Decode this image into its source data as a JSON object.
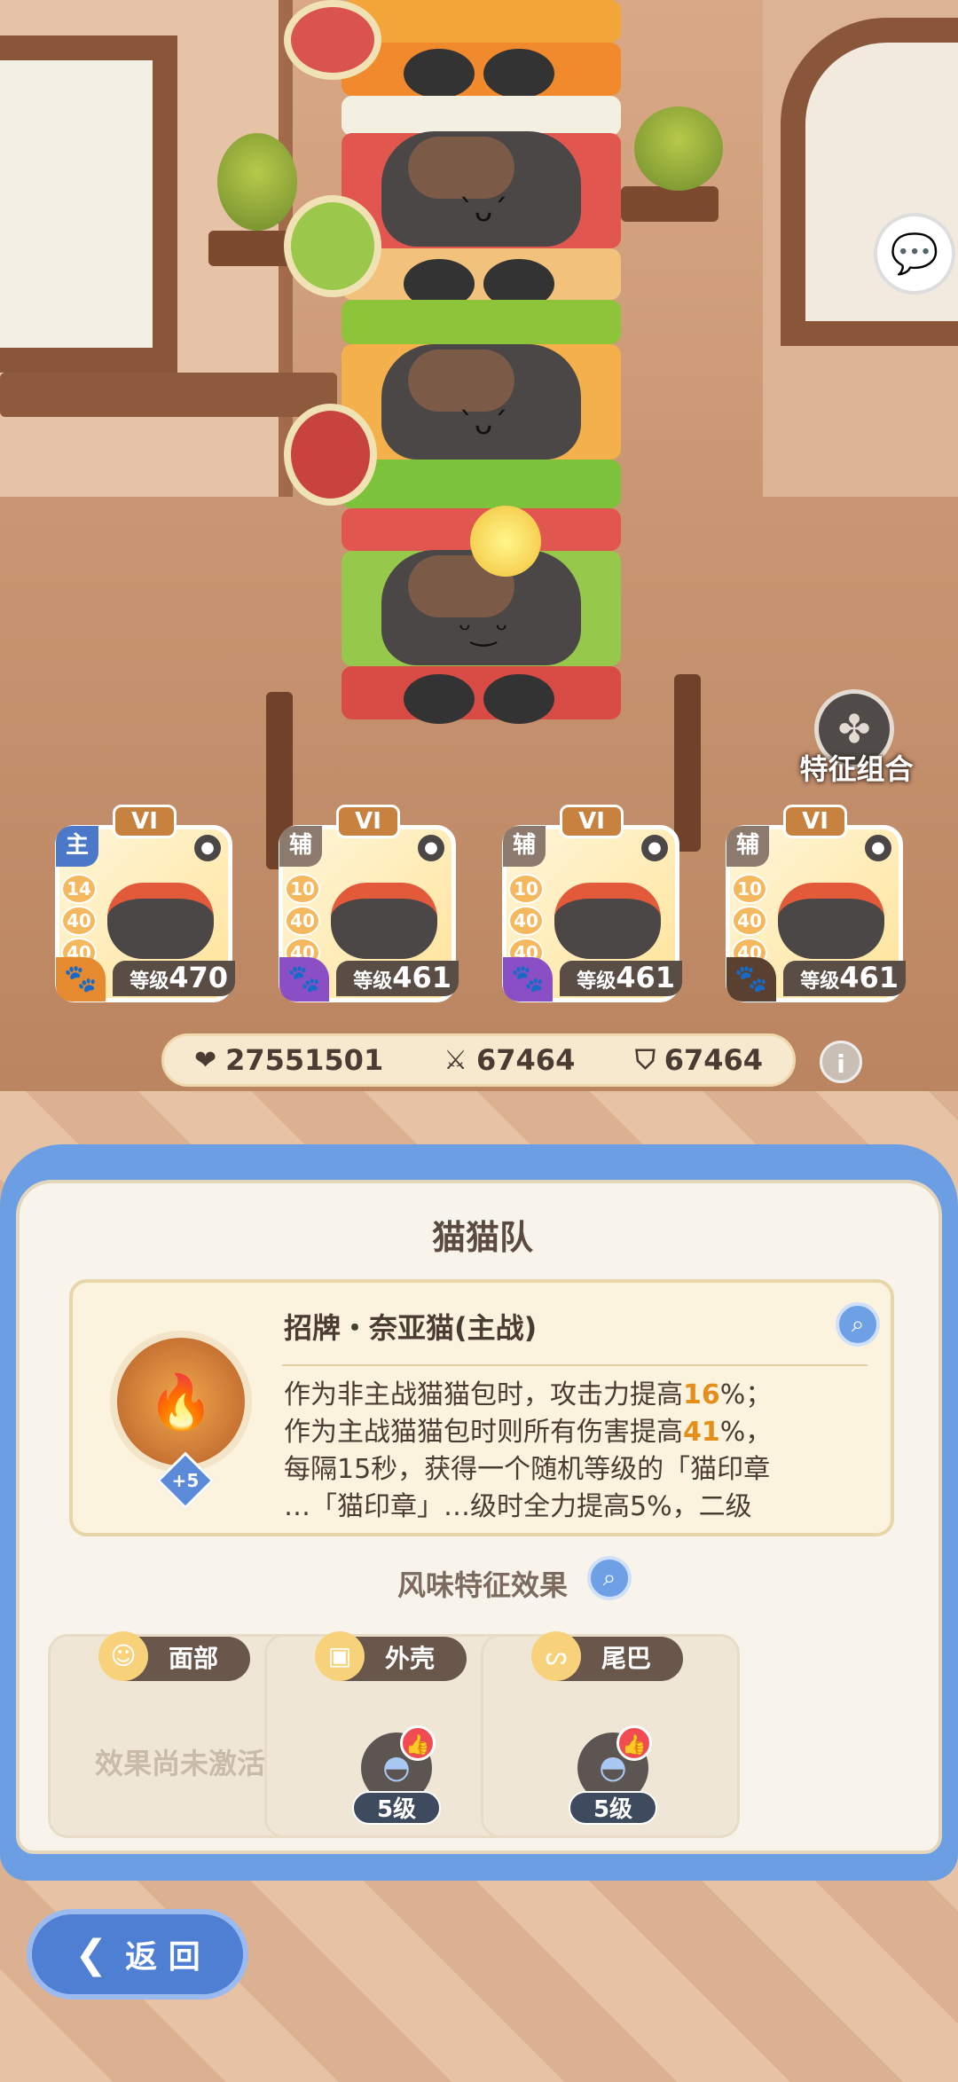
{
  "scene": {
    "chat_icon": "chat-bubble-icon",
    "trait_combo_label": "特征组合"
  },
  "team": {
    "members": [
      {
        "rank": "VI",
        "role": "主",
        "role_color": "#4c78c9",
        "stats": [
          "14",
          "40",
          "40"
        ],
        "level_prefix": "等级",
        "level": "470",
        "paw_color": "#e58a2e"
      },
      {
        "rank": "VI",
        "role": "辅",
        "role_color": "#8b7a6d",
        "stats": [
          "10",
          "40",
          "40"
        ],
        "level_prefix": "等级",
        "level": "461",
        "paw_color": "#8a4fc4"
      },
      {
        "rank": "VI",
        "role": "辅",
        "role_color": "#8b7a6d",
        "stats": [
          "10",
          "40",
          "40"
        ],
        "level_prefix": "等级",
        "level": "461",
        "paw_color": "#8a4fc4"
      },
      {
        "rank": "VI",
        "role": "辅",
        "role_color": "#8b7a6d",
        "stats": [
          "10",
          "40",
          "40"
        ],
        "level_prefix": "等级",
        "level": "461",
        "paw_color": "#5a4030"
      }
    ]
  },
  "stats": {
    "hp": "27551501",
    "attack": "67464",
    "defense": "67464",
    "info_label": "i"
  },
  "panel": {
    "title": "猫猫队",
    "skill": {
      "name": "招牌・奈亚猫(主战)",
      "badge": "+5",
      "desc_lines": [
        {
          "a": "作为非主战猫猫包时，攻击力提高",
          "hl": "16",
          "b": "%；"
        },
        {
          "a": "作为主战猫猫包时则所有伤害提高",
          "hl": "41",
          "b": "%，"
        },
        {
          "a": "每隔15秒，获得一个随机等级的「猫印章",
          "hl": "",
          "b": ""
        },
        {
          "a": "…「猫印章」…级时全力提高5%，二级",
          "hl": "",
          "b": ""
        }
      ]
    },
    "flavor_title": "风味特征效果",
    "slots": [
      {
        "label": "面部",
        "icon": "face-icon",
        "status": "效果尚未激活"
      },
      {
        "label": "外壳",
        "icon": "shell-icon",
        "level": "5级"
      },
      {
        "label": "尾巴",
        "icon": "tail-icon",
        "level": "5级"
      }
    ]
  },
  "back_button": {
    "label": "返 回"
  }
}
